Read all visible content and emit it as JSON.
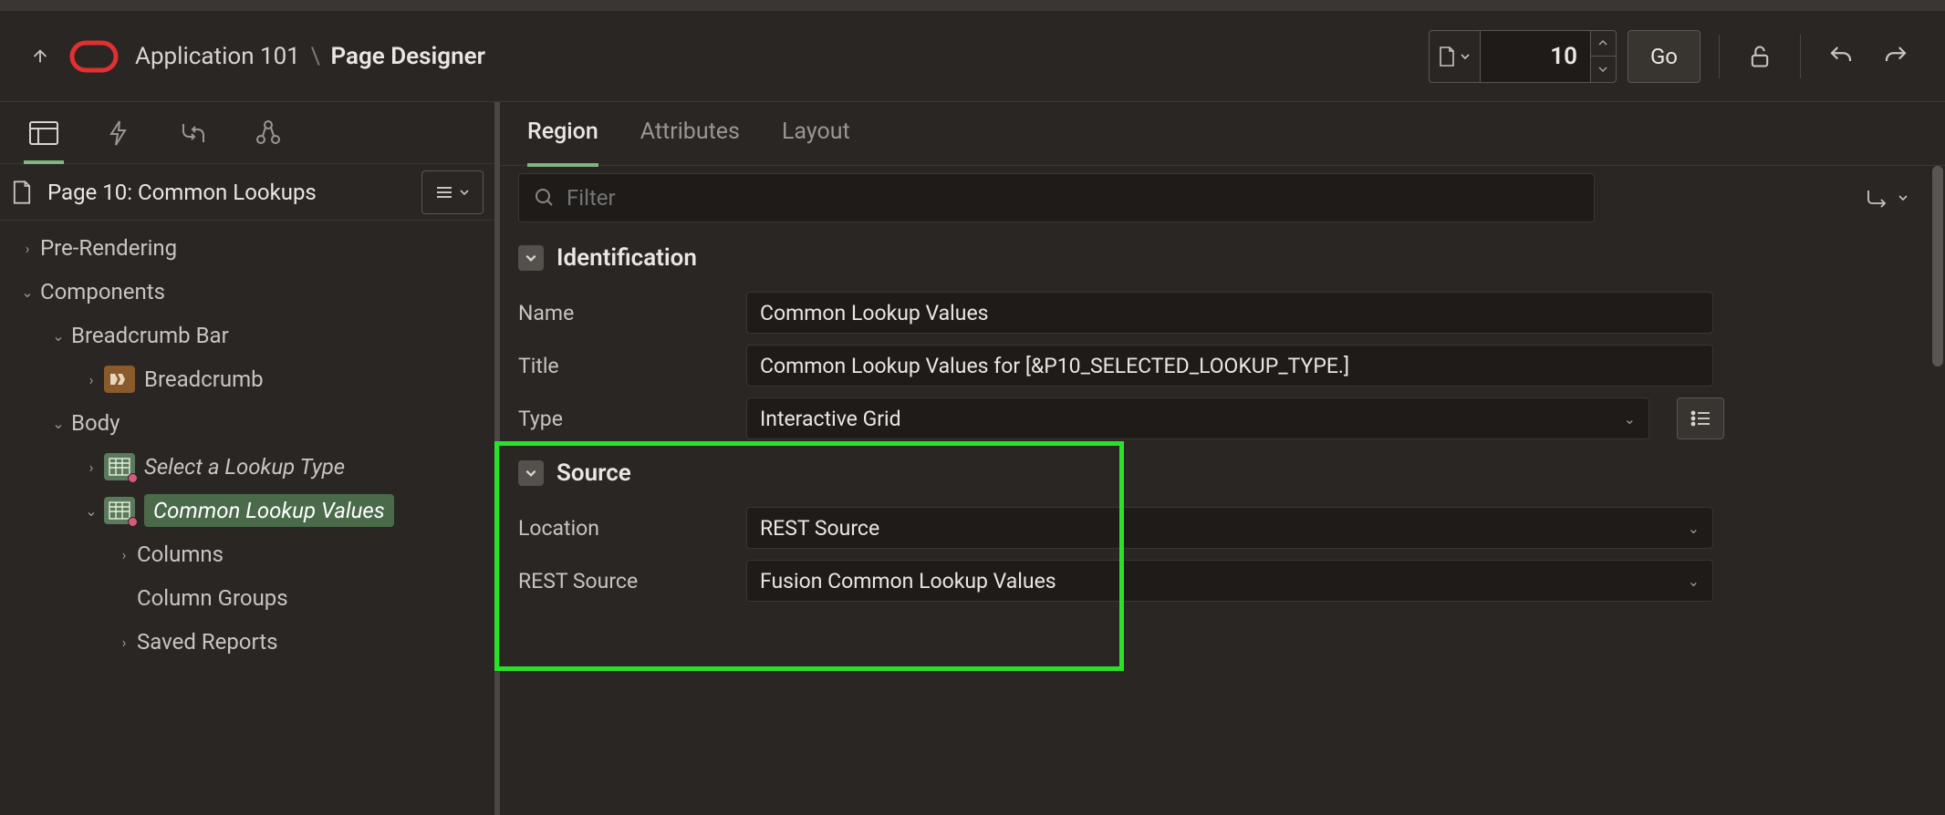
{
  "header": {
    "app_label": "Application 101",
    "separator": "\\",
    "page_title": "Page Designer",
    "page_number": "10",
    "go_label": "Go"
  },
  "left": {
    "page_label": "Page 10: Common Lookups",
    "tree": {
      "pre_rendering": "Pre-Rendering",
      "components": "Components",
      "breadcrumb_bar": "Breadcrumb Bar",
      "breadcrumb": "Breadcrumb",
      "body": "Body",
      "select_lookup": "Select a Lookup Type",
      "common_lookup": "Common Lookup Values",
      "columns": "Columns",
      "column_groups": "Column Groups",
      "saved_reports": "Saved Reports"
    }
  },
  "right": {
    "tabs": {
      "region": "Region",
      "attributes": "Attributes",
      "layout": "Layout"
    },
    "filter_placeholder": "Filter",
    "sections": {
      "identification": {
        "title": "Identification",
        "name_label": "Name",
        "name_value": "Common Lookup Values",
        "title_label": "Title",
        "title_value": "Common Lookup Values for [&P10_SELECTED_LOOKUP_TYPE.]",
        "type_label": "Type",
        "type_value": "Interactive Grid"
      },
      "source": {
        "title": "Source",
        "location_label": "Location",
        "location_value": "REST Source",
        "rest_label": "REST Source",
        "rest_value": "Fusion Common Lookup Values"
      }
    }
  }
}
